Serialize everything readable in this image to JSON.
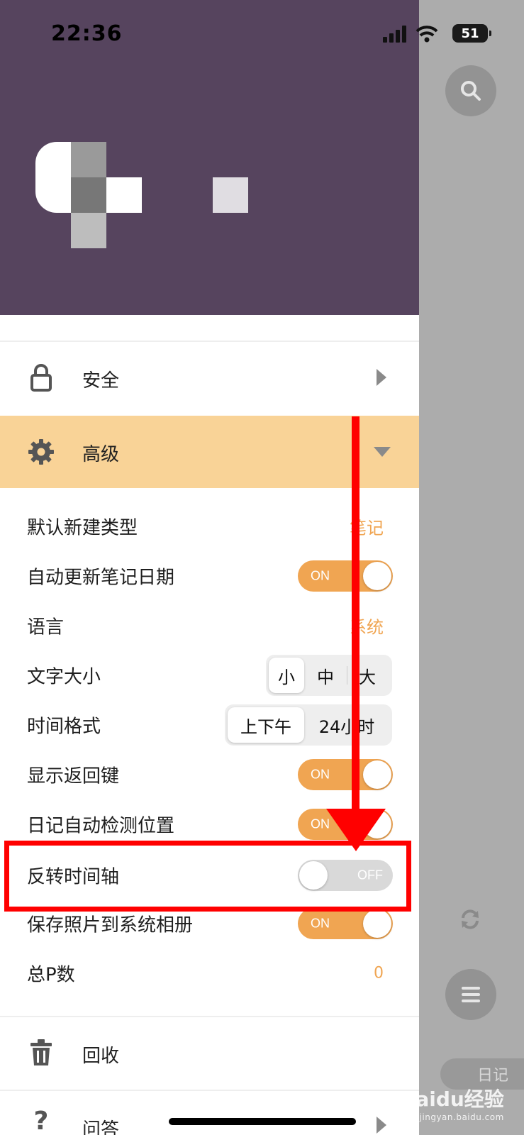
{
  "status_bar": {
    "time": "22:36",
    "battery": "51"
  },
  "menu": {
    "security_label": "安全",
    "advanced_label": "高级",
    "recycle_label": "回收",
    "faq_label": "问答"
  },
  "settings": {
    "default_type": {
      "label": "默认新建类型",
      "value": "笔记"
    },
    "auto_update_date": {
      "label": "自动更新笔记日期",
      "state": "ON"
    },
    "language": {
      "label": "语言",
      "value": "系统"
    },
    "font_size": {
      "label": "文字大小",
      "options": [
        "小",
        "中",
        "大"
      ],
      "selected": "小"
    },
    "time_format": {
      "label": "时间格式",
      "options": [
        "上下午",
        "24小时"
      ],
      "selected": "上下午"
    },
    "show_back": {
      "label": "显示返回键",
      "state": "ON"
    },
    "diary_location": {
      "label": "日记自动检测位置",
      "state": "ON"
    },
    "reverse_timeline": {
      "label": "反转时间轴",
      "state": "OFF"
    },
    "save_photos": {
      "label": "保存照片到系统相册",
      "state": "ON"
    },
    "total_p": {
      "label": "总P数",
      "value": "0"
    }
  },
  "right_panel": {
    "diary_tab": "日记"
  },
  "watermark": {
    "brand": "Baidu经验",
    "url": "jingyan.baidu.com"
  },
  "colors": {
    "header": "#56445e",
    "accent": "#f0a552",
    "advanced_bg": "#f9d397",
    "annotation": "#ff0000"
  }
}
